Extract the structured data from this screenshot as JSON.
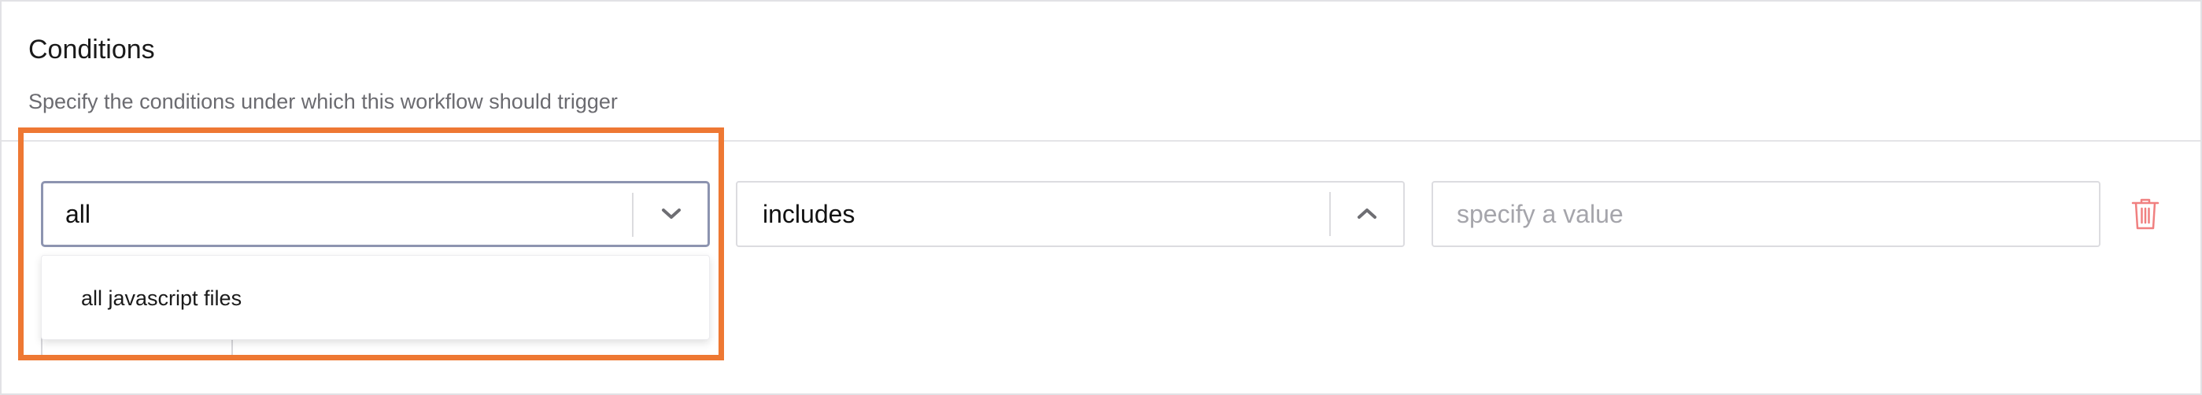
{
  "section": {
    "title": "Conditions",
    "subtitle": "Specify the conditions under which this workflow should trigger"
  },
  "condition": {
    "field": {
      "value": "all",
      "options": [
        "all javascript files"
      ],
      "chevron": "chevron-down-icon"
    },
    "operator": {
      "value": "includes",
      "chevron": "chevron-up-icon"
    },
    "value_input": {
      "value": "",
      "placeholder": "specify a value"
    },
    "delete_icon": "trash-icon"
  },
  "colors": {
    "highlight": "#ee7833",
    "focus_border": "#8d94b0",
    "delete": "#f08080"
  }
}
